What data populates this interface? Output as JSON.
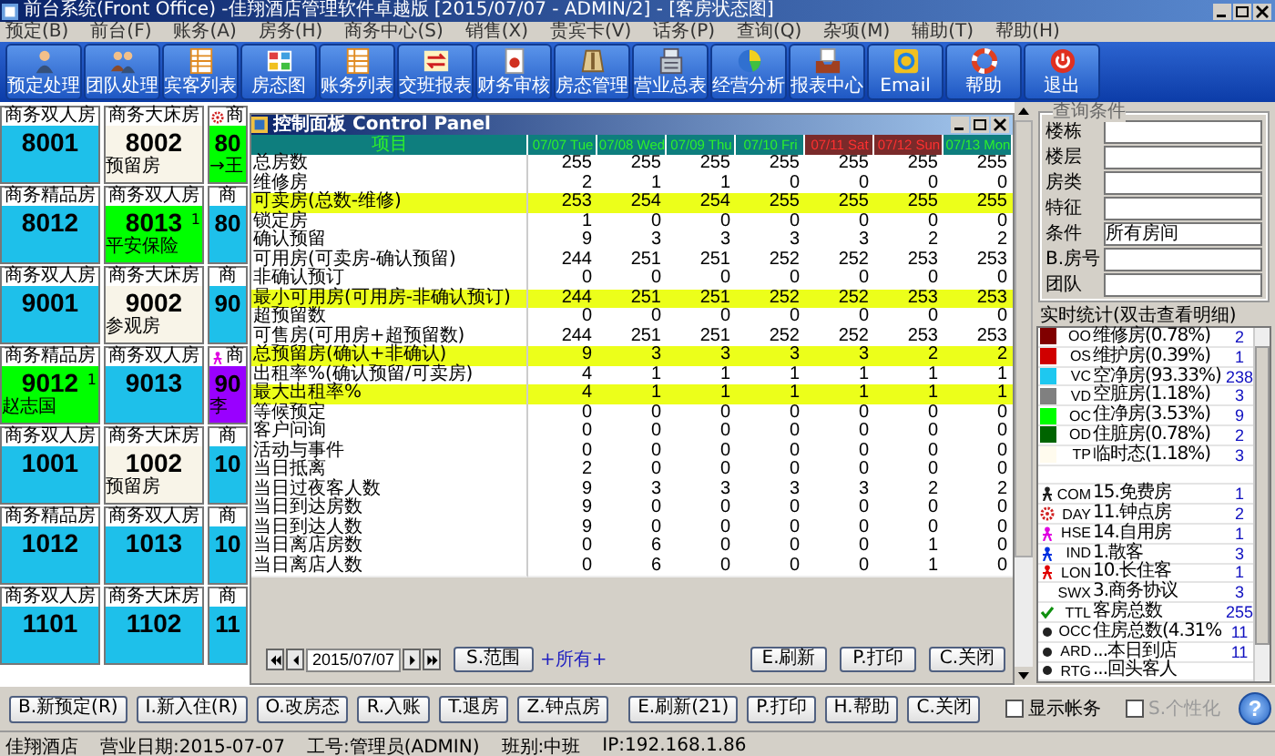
{
  "window": {
    "title": "前台系统(Front Office) -佳翔酒店管理软件卓越版 [2015/07/07 - ADMIN/2] - [客房状态图]"
  },
  "menu": [
    "预定(B)",
    "前台(F)",
    "账务(A)",
    "房务(H)",
    "商务中心(S)",
    "销售(X)",
    "贵宾卡(V)",
    "话务(P)",
    "查询(Q)",
    "杂项(M)",
    "辅助(T)",
    "帮助(H)"
  ],
  "toolbar": [
    "预定处理",
    "团队处理",
    "宾客列表",
    "房态图",
    "账务列表",
    "交班报表",
    "财务审核",
    "房态管理",
    "营业总表",
    "经营分析",
    "报表中心",
    "Email",
    "帮助",
    "退出"
  ],
  "room_grid": [
    [
      {
        "type": "商务双人房",
        "number": "8001",
        "color": "#1ec0ea"
      },
      {
        "type": "商务大床房",
        "number": "8002",
        "guest": "预留房",
        "color": "#f8f4e8"
      },
      {
        "type": "商",
        "number": "80",
        "guest": "→王",
        "hourly": true,
        "color": "#00ff00"
      }
    ],
    [
      {
        "type": "商务精品房",
        "number": "8012",
        "color": "#1ec0ea"
      },
      {
        "type": "商务双人房",
        "number": "8013",
        "guest": "平安保险",
        "count": "1",
        "color": "#00ff00"
      },
      {
        "type": "商",
        "number": "80",
        "color": "#1ec0ea"
      }
    ],
    [
      {
        "type": "商务双人房",
        "number": "9001",
        "color": "#1ec0ea"
      },
      {
        "type": "商务大床房",
        "number": "9002",
        "guest": "参观房",
        "color": "#f8f4e8"
      },
      {
        "type": "商",
        "number": "90",
        "color": "#1ec0ea"
      }
    ],
    [
      {
        "type": "商务精品房",
        "number": "9012",
        "guest": "赵志国",
        "count": "1",
        "color": "#00ff00"
      },
      {
        "type": "商务双人房",
        "number": "9013",
        "color": "#1ec0ea"
      },
      {
        "type": "商",
        "number": "90",
        "guest": "李",
        "own_use": true,
        "color": "#9900ff"
      }
    ],
    [
      {
        "type": "商务双人房",
        "number": "1001",
        "color": "#1ec0ea"
      },
      {
        "type": "商务大床房",
        "number": "1002",
        "guest": "预留房",
        "color": "#f8f4e8"
      },
      {
        "type": "商",
        "number": "10",
        "color": "#1ec0ea"
      }
    ],
    [
      {
        "type": "商务精品房",
        "number": "1012",
        "color": "#1ec0ea"
      },
      {
        "type": "商务双人房",
        "number": "1013",
        "color": "#1ec0ea"
      },
      {
        "type": "商",
        "number": "10",
        "color": "#1ec0ea"
      }
    ],
    [
      {
        "type": "商务双人房",
        "number": "1101",
        "color": "#1ec0ea"
      },
      {
        "type": "商务大床房",
        "number": "1102",
        "color": "#1ec0ea"
      },
      {
        "type": "商",
        "number": "11",
        "color": "#1ec0ea"
      }
    ]
  ],
  "control_panel": {
    "title": "控制面板 Control Panel",
    "label_header": "项目",
    "columns": [
      {
        "label": "07/07 Tue",
        "weekend": false
      },
      {
        "label": "07/08 Wed",
        "weekend": false
      },
      {
        "label": "07/09 Thu",
        "weekend": false
      },
      {
        "label": "07/10 Fri",
        "weekend": false
      },
      {
        "label": "07/11 Sat",
        "weekend": true
      },
      {
        "label": "07/12 Sun",
        "weekend": true
      },
      {
        "label": "07/13 Mon",
        "weekend": false
      }
    ],
    "rows": [
      {
        "label": "总房数",
        "values": [
          "255",
          "255",
          "255",
          "255",
          "255",
          "255",
          "255"
        ],
        "highlight": false
      },
      {
        "label": "维修房",
        "values": [
          "2",
          "1",
          "1",
          "0",
          "0",
          "0",
          "0"
        ],
        "highlight": false
      },
      {
        "label": "可卖房(总数-维修)",
        "values": [
          "253",
          "254",
          "254",
          "255",
          "255",
          "255",
          "255"
        ],
        "highlight": true
      },
      {
        "label": "锁定房",
        "values": [
          "1",
          "0",
          "0",
          "0",
          "0",
          "0",
          "0"
        ],
        "highlight": false
      },
      {
        "label": "确认预留",
        "values": [
          "9",
          "3",
          "3",
          "3",
          "3",
          "2",
          "2"
        ],
        "highlight": false
      },
      {
        "label": "可用房(可卖房-确认预留)",
        "values": [
          "244",
          "251",
          "251",
          "252",
          "252",
          "253",
          "253"
        ],
        "highlight": false
      },
      {
        "label": "非确认预订",
        "values": [
          "0",
          "0",
          "0",
          "0",
          "0",
          "0",
          "0"
        ],
        "highlight": false
      },
      {
        "label": "最小可用房(可用房-非确认预订)",
        "values": [
          "244",
          "251",
          "251",
          "252",
          "252",
          "253",
          "253"
        ],
        "highlight": true
      },
      {
        "label": "超预留数",
        "values": [
          "0",
          "0",
          "0",
          "0",
          "0",
          "0",
          "0"
        ],
        "highlight": false
      },
      {
        "label": "可售房(可用房+超预留数)",
        "values": [
          "244",
          "251",
          "251",
          "252",
          "252",
          "253",
          "253"
        ],
        "highlight": false
      },
      {
        "label": "总预留房(确认+非确认)",
        "values": [
          "9",
          "3",
          "3",
          "3",
          "3",
          "2",
          "2"
        ],
        "highlight": true
      },
      {
        "label": "出租率%(确认预留/可卖房)",
        "values": [
          "4",
          "1",
          "1",
          "1",
          "1",
          "1",
          "1"
        ],
        "highlight": false
      },
      {
        "label": "最大出租率%",
        "values": [
          "4",
          "1",
          "1",
          "1",
          "1",
          "1",
          "1"
        ],
        "highlight": true
      },
      {
        "label": "等候预定",
        "values": [
          "0",
          "0",
          "0",
          "0",
          "0",
          "0",
          "0"
        ],
        "highlight": false
      },
      {
        "label": "客户问询",
        "values": [
          "0",
          "0",
          "0",
          "0",
          "0",
          "0",
          "0"
        ],
        "highlight": false
      },
      {
        "label": "活动与事件",
        "values": [
          "0",
          "0",
          "0",
          "0",
          "0",
          "0",
          "0"
        ],
        "highlight": false
      },
      {
        "label": "当日抵离",
        "values": [
          "2",
          "0",
          "0",
          "0",
          "0",
          "0",
          "0"
        ],
        "highlight": false
      },
      {
        "label": "当日过夜客人数",
        "values": [
          "9",
          "3",
          "3",
          "3",
          "3",
          "2",
          "2"
        ],
        "highlight": false
      },
      {
        "label": "当日到达房数",
        "values": [
          "9",
          "0",
          "0",
          "0",
          "0",
          "0",
          "0"
        ],
        "highlight": false
      },
      {
        "label": "当日到达人数",
        "values": [
          "9",
          "0",
          "0",
          "0",
          "0",
          "0",
          "0"
        ],
        "highlight": false
      },
      {
        "label": "当日离店房数",
        "values": [
          "0",
          "6",
          "0",
          "0",
          "0",
          "1",
          "0"
        ],
        "highlight": false
      },
      {
        "label": "当日离店人数",
        "values": [
          "0",
          "6",
          "0",
          "0",
          "0",
          "1",
          "0"
        ],
        "highlight": false
      }
    ],
    "date": "2015/07/07",
    "range_button": "S.范围",
    "range_link": "+所有+",
    "buttons": [
      "E.刷新",
      "P.打印",
      "C.关闭"
    ]
  },
  "query": {
    "title": "查询条件",
    "fields": [
      {
        "label": "楼栋"
      },
      {
        "label": "楼层"
      },
      {
        "label": "房类"
      },
      {
        "label": "特征"
      },
      {
        "label": "条件",
        "value": "所有房间"
      },
      {
        "label": "B.房号"
      },
      {
        "label": "团队"
      }
    ]
  },
  "stats": {
    "title": "实时统计(双击查看明细)",
    "items": [
      {
        "kind": "swatch",
        "color": "#800000",
        "code": "OO",
        "label": "维修房(0.78%)",
        "count": "2"
      },
      {
        "kind": "swatch",
        "color": "#d00000",
        "code": "OS",
        "label": "维护房(0.39%)",
        "count": "1"
      },
      {
        "kind": "swatch",
        "color": "#1ec8f0",
        "code": "VC",
        "label": "空净房(93.33%)",
        "count": "238"
      },
      {
        "kind": "swatch",
        "color": "#808080",
        "code": "VD",
        "label": "空脏房(1.18%)",
        "count": "3"
      },
      {
        "kind": "swatch",
        "color": "#00ff00",
        "code": "OC",
        "label": "住净房(3.53%)",
        "count": "9"
      },
      {
        "kind": "swatch",
        "color": "#006400",
        "code": "OD",
        "label": "住脏房(0.78%)",
        "count": "2"
      },
      {
        "kind": "swatch",
        "color": "#fffbee",
        "code": "TP",
        "label": "临时态(1.18%)",
        "count": "3"
      },
      {
        "kind": "blank"
      },
      {
        "kind": "person",
        "color": "#202020",
        "code": "COM",
        "label": "15.免费房",
        "count": "1"
      },
      {
        "kind": "gear",
        "code": "DAY",
        "label": "11.钟点房",
        "count": "2"
      },
      {
        "kind": "person",
        "color": "#e000e0",
        "code": "HSE",
        "label": "14.自用房",
        "count": "1"
      },
      {
        "kind": "person",
        "color": "#0030e0",
        "code": "IND",
        "label": "1.散客",
        "count": "3"
      },
      {
        "kind": "person",
        "color": "#e00000",
        "code": "LON",
        "label": "10.长住客",
        "count": "1"
      },
      {
        "kind": "plain",
        "code": "SWX",
        "label": "3.商务协议",
        "count": "3"
      },
      {
        "kind": "check",
        "code": "TTL",
        "label": "客房总数",
        "count": "255"
      },
      {
        "kind": "dot",
        "code": "OCC",
        "label": "住房总数(4.31%",
        "count": "11"
      },
      {
        "kind": "dot",
        "code": "ARD",
        "label": "...本日到店",
        "count": "11"
      },
      {
        "kind": "dot",
        "code": "RTG",
        "label": "...回头客人"
      }
    ]
  },
  "actions_left": [
    "B.新预定(R)",
    "I.新入住(R)",
    "O.改房态",
    "R.入账",
    "T.退房",
    "Z.钟点房"
  ],
  "actions_right": [
    "E.刷新(21)",
    "P.打印",
    "H.帮助",
    "C.关闭"
  ],
  "checkboxes": [
    {
      "label": "显示帐务",
      "checked": false,
      "disabled": false
    },
    {
      "label": "S.个性化",
      "checked": false,
      "disabled": true
    }
  ],
  "help_button": "?",
  "status_bar": [
    "佳翔酒店",
    "营业日期:2015-07-07",
    "工号:管理员(ADMIN)",
    "班别:中班",
    "IP:192.168.1.86"
  ]
}
